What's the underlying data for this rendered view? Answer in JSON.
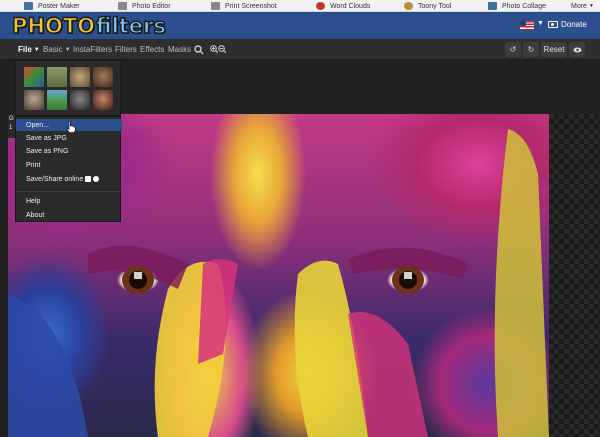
{
  "topbar": {
    "links": [
      {
        "label": "Poster Maker",
        "icon": "poster-icon",
        "color": "#4a6fa5"
      },
      {
        "label": "Photo Editor",
        "icon": "photo-editor-icon",
        "color": "#888888"
      },
      {
        "label": "Print Screenshot",
        "icon": "print-screenshot-icon",
        "color": "#888888"
      },
      {
        "label": "Word Clouds",
        "icon": "word-clouds-icon",
        "color": "#c0392b"
      },
      {
        "label": "Toony Tool",
        "icon": "toony-icon",
        "color": "#b58d3d"
      },
      {
        "label": "Photo Collage",
        "icon": "photo-collage-icon",
        "color": "#3a6ea5"
      },
      {
        "label": "More",
        "icon": "chevron-down-icon",
        "color": "#333333"
      }
    ]
  },
  "brand": {
    "logo_part1": "PHOTO",
    "logo_part2": "filters",
    "donate_label": "Donate",
    "color": "#2b4e8c"
  },
  "toolbar": {
    "menus": [
      "File",
      "Basic",
      "InstaFilters",
      "Filters",
      "Effects",
      "Masks"
    ],
    "reset_label": "Reset"
  },
  "file_menu": {
    "items": [
      "Open...",
      "Save as JPG",
      "Save as PNG",
      "Print",
      "Save/Share online",
      "Help",
      "About"
    ],
    "active_item": "Open..."
  },
  "thumbnails": [
    {
      "name": "parrot",
      "color": "#4a8c3a"
    },
    {
      "name": "landscape",
      "color": "#6a7a4a"
    },
    {
      "name": "cat",
      "color": "#8a6a4a"
    },
    {
      "name": "portrait-1",
      "color": "#5a3a2a"
    },
    {
      "name": "portrait-2",
      "color": "#6a5a4a"
    },
    {
      "name": "field",
      "color": "#3a8a4a"
    },
    {
      "name": "portrait-3",
      "color": "#3a3a3a"
    },
    {
      "name": "portrait-4",
      "color": "#7a4a3a"
    }
  ],
  "canvas": {
    "leftclip": [
      "G",
      "1"
    ]
  }
}
